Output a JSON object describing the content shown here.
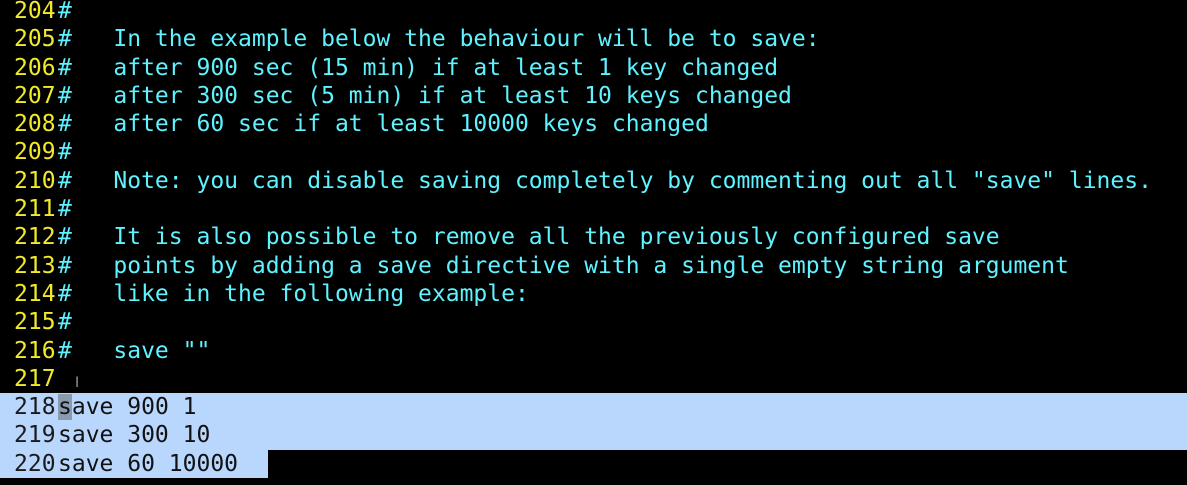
{
  "editor": {
    "lines": [
      {
        "num": "204",
        "text": "#"
      },
      {
        "num": "205",
        "text": "#   In the example below the behaviour will be to save:"
      },
      {
        "num": "206",
        "text": "#   after 900 sec (15 min) if at least 1 key changed"
      },
      {
        "num": "207",
        "text": "#   after 300 sec (5 min) if at least 10 keys changed"
      },
      {
        "num": "208",
        "text": "#   after 60 sec if at least 10000 keys changed"
      },
      {
        "num": "209",
        "text": "#"
      },
      {
        "num": "210",
        "text": "#   Note: you can disable saving completely by commenting out all \"save\" lines."
      },
      {
        "num": "211",
        "text": "#"
      },
      {
        "num": "212",
        "text": "#   It is also possible to remove all the previously configured save"
      },
      {
        "num": "213",
        "text": "#   points by adding a save directive with a single empty string argument"
      },
      {
        "num": "214",
        "text": "#   like in the following example:"
      },
      {
        "num": "215",
        "text": "#"
      },
      {
        "num": "216",
        "text": "#   save \"\""
      },
      {
        "num": "217",
        "text": ""
      }
    ],
    "selected_lines": [
      {
        "num": "218",
        "cursor_char": "s",
        "text": "ave 900 1"
      },
      {
        "num": "219",
        "text": "save 300 10"
      },
      {
        "num": "220",
        "text": "save 60 10000"
      }
    ],
    "colors": {
      "background": "#000000",
      "line_number": "#f1ea2b",
      "comment": "#5ff2ff",
      "selection": "#b9d6fc"
    },
    "mouse_cursor_icon": "i-beam-cursor-icon"
  }
}
